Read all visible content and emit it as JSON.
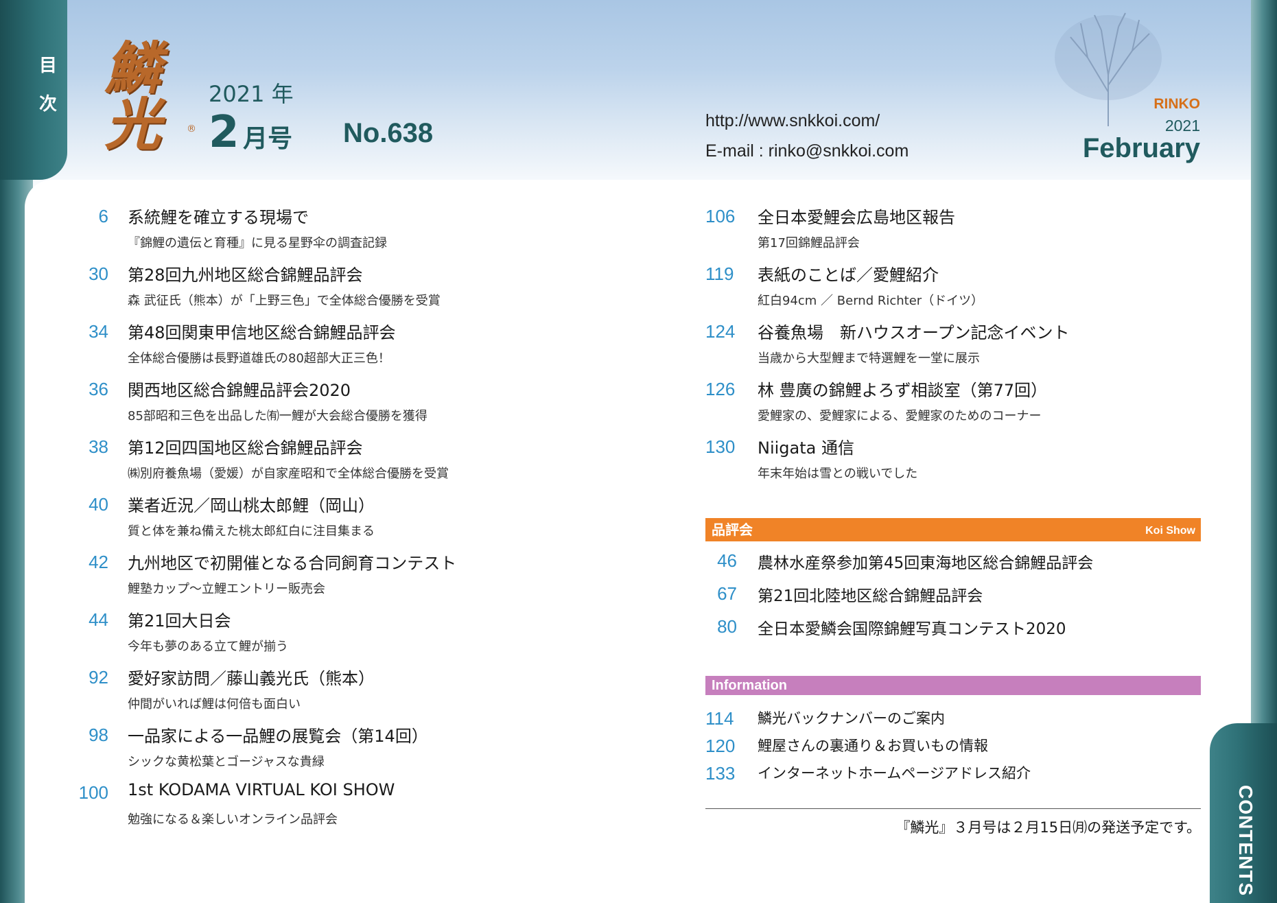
{
  "side_tab": {
    "left_label": "目次",
    "right_label": "CONTENTS"
  },
  "header": {
    "logo_text": "鱗光",
    "year": "2021 年",
    "issue_month": "2",
    "issue_suffix": "月号",
    "number": "No.638",
    "url": "http://www.snkkoi.com/",
    "email": "E-mail : rinko@snkkoi.com",
    "brand": "RINKO",
    "brand_year": "2021",
    "month_en": "February"
  },
  "toc_left": [
    {
      "page": "6",
      "title": "系統鯉を確立する現場で",
      "sub": "『錦鯉の遺伝と育種』に見る星野伞の調査記録"
    },
    {
      "page": "30",
      "title": "第28回九州地区総合錦鯉品評会",
      "sub": "森 武征氏（熊本）が「上野三色」で全体総合優勝を受賞"
    },
    {
      "page": "34",
      "title": "第48回関東甲信地区総合錦鯉品評会",
      "sub": "全体総合優勝は長野道雄氏の80超部大正三色！"
    },
    {
      "page": "36",
      "title": "関西地区総合錦鯉品評会2020",
      "sub": "85部昭和三色を出品した㈲一鯉が大会総合優勝を獲得"
    },
    {
      "page": "38",
      "title": "第12回四国地区総合錦鯉品評会",
      "sub": "㈱別府養魚場（愛媛）が自家産昭和で全体総合優勝を受賞"
    },
    {
      "page": "40",
      "title": "業者近況／岡山桃太郎鯉（岡山）",
      "sub": "質と体を兼ね備えた桃太郎紅白に注目集まる"
    },
    {
      "page": "42",
      "title": "九州地区で初開催となる合同飼育コンテスト",
      "sub": "鯉塾カップ〜立鯉エントリー販売会"
    },
    {
      "page": "44",
      "title": "第21回大日会",
      "sub": "今年も夢のある立て鯉が揃う"
    },
    {
      "page": "92",
      "title": "愛好家訪問／藤山義光氏（熊本）",
      "sub": "仲間がいれば鯉は何倍も面白い"
    },
    {
      "page": "98",
      "title": "一品家による一品鯉の展覧会（第14回）",
      "sub": "シックな黄松葉とゴージャスな貴緑"
    },
    {
      "page": "100",
      "title": "1st KODAMA VIRTUAL KOI SHOW",
      "sub": "勉強になる＆楽しいオンライン品評会"
    }
  ],
  "toc_right": [
    {
      "page": "106",
      "title": "全日本愛鯉会広島地区報告",
      "sub": "第17回錦鯉品評会"
    },
    {
      "page": "119",
      "title": "表紙のことば／愛鯉紹介",
      "sub": "紅白94cm ／ Bernd Richter（ドイツ）"
    },
    {
      "page": "124",
      "title": "谷養魚場　新ハウスオープン記念イベント",
      "sub": "当歳から大型鯉まで特選鯉を一堂に展示"
    },
    {
      "page": "126",
      "title": "林 豊廣の錦鯉よろず相談室（第77回）",
      "sub": "愛鯉家の、愛鯉家による、愛鯉家のためのコーナー"
    },
    {
      "page": "130",
      "title": "Niigata 通信",
      "sub": "年末年始は雪との戦いでした"
    }
  ],
  "koi_show": {
    "label": "品評会",
    "label_en": "Koi Show",
    "color": "#f08327",
    "items": [
      {
        "page": "46",
        "title": "農林水産祭参加第45回東海地区総合錦鯉品評会"
      },
      {
        "page": "67",
        "title": "第21回北陸地区総合錦鯉品評会"
      },
      {
        "page": "80",
        "title": "全日本愛鱗会国際錦鯉写真コンテスト2020"
      }
    ]
  },
  "information": {
    "label": "Information",
    "color": "#c67fbd",
    "items": [
      {
        "page": "114",
        "title": "鱗光バックナンバーのご案内"
      },
      {
        "page": "120",
        "title": "鯉屋さんの裏通り＆お買いもの情報"
      },
      {
        "page": "133",
        "title": "インターネットホームページアドレス紹介"
      }
    ]
  },
  "footer_note": "『鱗光』３月号は２月15日㈪の発送予定です。",
  "colors": {
    "accent": "#205a5e",
    "page_number": "#2e8fc8",
    "brand": "#d6701a"
  }
}
